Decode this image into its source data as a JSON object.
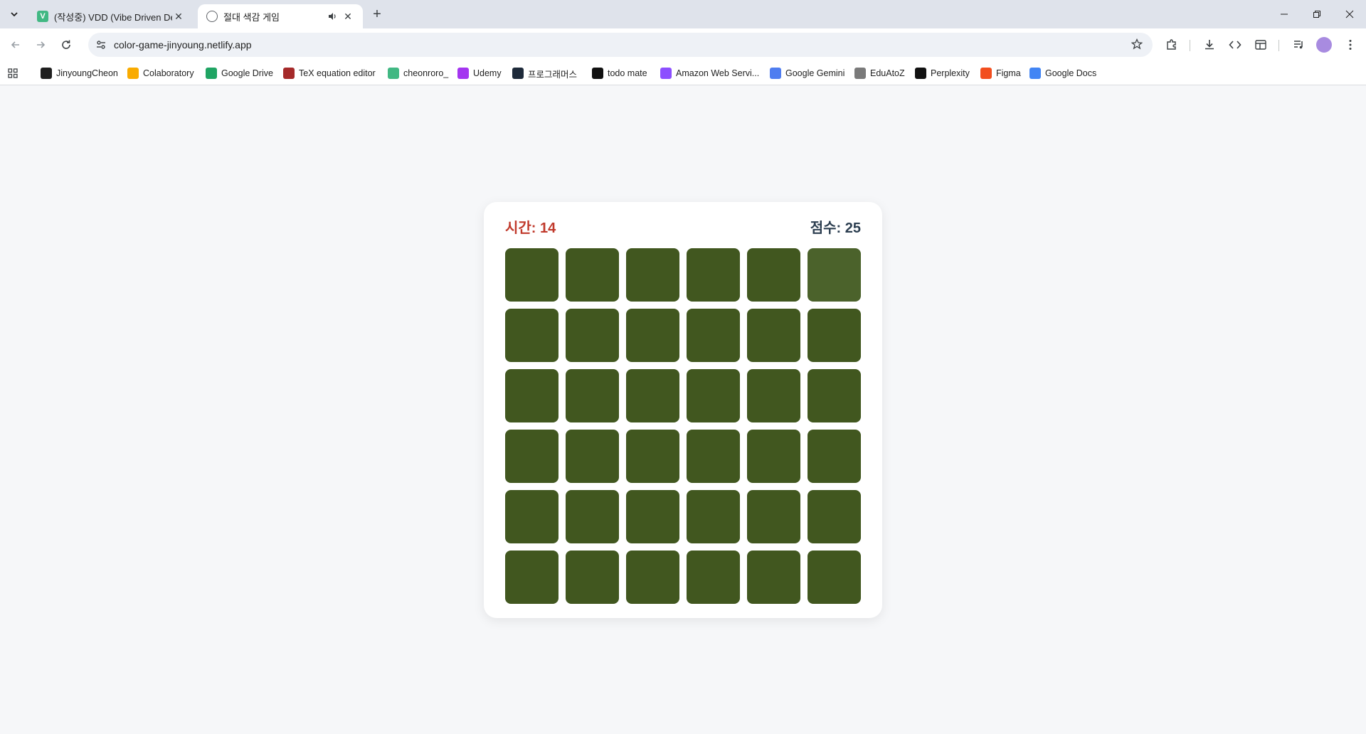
{
  "browser": {
    "tabs": [
      {
        "title": "(작성중) VDD (Vibe Driven De",
        "favicon": "vue-v-icon",
        "active": false
      },
      {
        "title": "절대 색감 게임",
        "favicon": "globe-icon",
        "active": true
      }
    ],
    "url": "color-game-jinyoung.netlify.app",
    "bookmarks": [
      {
        "label": "JinyoungCheon",
        "icon": "github-icon",
        "color": "#1f1f1f"
      },
      {
        "label": "Colaboratory",
        "icon": "colab-icon",
        "color": "#f9ab00"
      },
      {
        "label": "Google Drive",
        "icon": "drive-icon",
        "color": "#1fa463"
      },
      {
        "label": "TeX equation editor",
        "icon": "tex-icon",
        "color": "#a52a2a"
      },
      {
        "label": "cheonroro_",
        "icon": "vue-v-icon",
        "color": "#41b883"
      },
      {
        "label": "Udemy",
        "icon": "udemy-icon",
        "color": "#a435f0"
      },
      {
        "label": "프로그래머스",
        "icon": "programmers-icon",
        "color": "#1e2a3a"
      },
      {
        "label": "todo mate",
        "icon": "todomate-icon",
        "color": "#111111"
      },
      {
        "label": "Amazon Web Servi...",
        "icon": "aws-cube-icon",
        "color": "#8c4fff"
      },
      {
        "label": "Google Gemini",
        "icon": "gemini-icon",
        "color": "#4f7df0"
      },
      {
        "label": "EduAtoZ",
        "icon": "eduatoz-icon",
        "color": "#7a7a7a"
      },
      {
        "label": "Perplexity",
        "icon": "perplexity-icon",
        "color": "#111111"
      },
      {
        "label": "Figma",
        "icon": "figma-icon",
        "color": "#f24e1e"
      },
      {
        "label": "Google Docs",
        "icon": "docs-icon",
        "color": "#4285f4"
      }
    ]
  },
  "game": {
    "time_label": "시간: 14",
    "score_label": "점수: 25",
    "tile_color": "#41571f",
    "odd_tile_color": "#4b622b",
    "odd_tile_index": 5,
    "grid_size": 6
  }
}
